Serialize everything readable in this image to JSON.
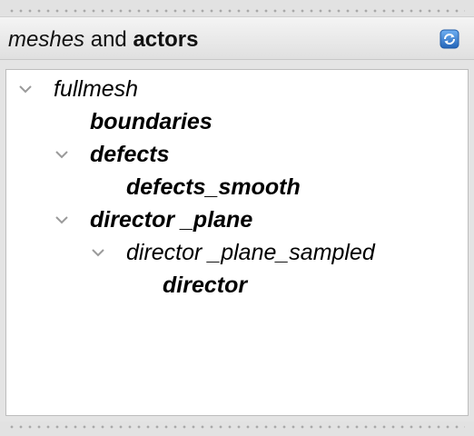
{
  "panel": {
    "title_italic": "meshes",
    "title_joiner": " and ",
    "title_bold": "actors",
    "refresh_icon": "refresh-icon"
  },
  "tree": {
    "nodes": [
      {
        "label": "fullmesh",
        "level": 0,
        "expanded": true,
        "style": "italic"
      },
      {
        "label": "boundaries",
        "level": 1,
        "expanded": null,
        "style": "bold"
      },
      {
        "label": "defects",
        "level": 1,
        "expanded": true,
        "style": "bold"
      },
      {
        "label": "defects_smooth",
        "level": 2,
        "expanded": null,
        "style": "bold"
      },
      {
        "label": "director _plane",
        "level": 1,
        "expanded": true,
        "style": "bold"
      },
      {
        "label": "director _plane_sampled",
        "level": 2,
        "expanded": true,
        "style": "italic"
      },
      {
        "label": "director",
        "level": 3,
        "expanded": null,
        "style": "bold"
      }
    ]
  },
  "colors": {
    "accent_blue": "#3a7fd0",
    "chevron": "#9a9a9a"
  }
}
